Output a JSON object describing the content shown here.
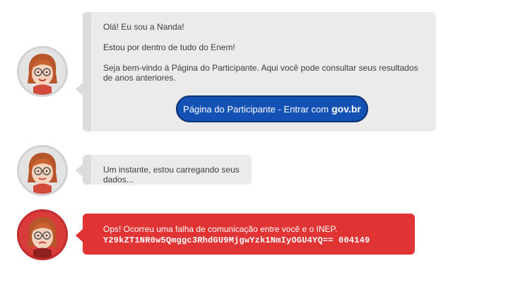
{
  "messages": {
    "greeting": {
      "line1": "Olá! Eu sou a Nanda!",
      "line2": "Estou por dentro de tudo do Enem!",
      "line3": "Seja bem-vindo à Página do Participante. Aqui você pode consultar seus resultados de anos anteriores.",
      "button_label": "Página do Participante - Entrar com",
      "button_brand": "gov.br"
    },
    "loading": {
      "text": "Um instante, estou carregando seus dados..."
    },
    "error": {
      "text": "Ops! Ocorreu uma falha de comunicação entre você e o INEP.",
      "code": "Y29kZT1NR0w5Qmggc3RhdGU9MjgwYzk1NmIyOGU4YQ== 004149"
    }
  },
  "avatar": {
    "icon": "nanda-avatar-icon"
  },
  "colors": {
    "bubble": "#ebebeb",
    "bubble_accent": "#dcdcdc",
    "button": "#1351b4",
    "error": "#e03333"
  }
}
